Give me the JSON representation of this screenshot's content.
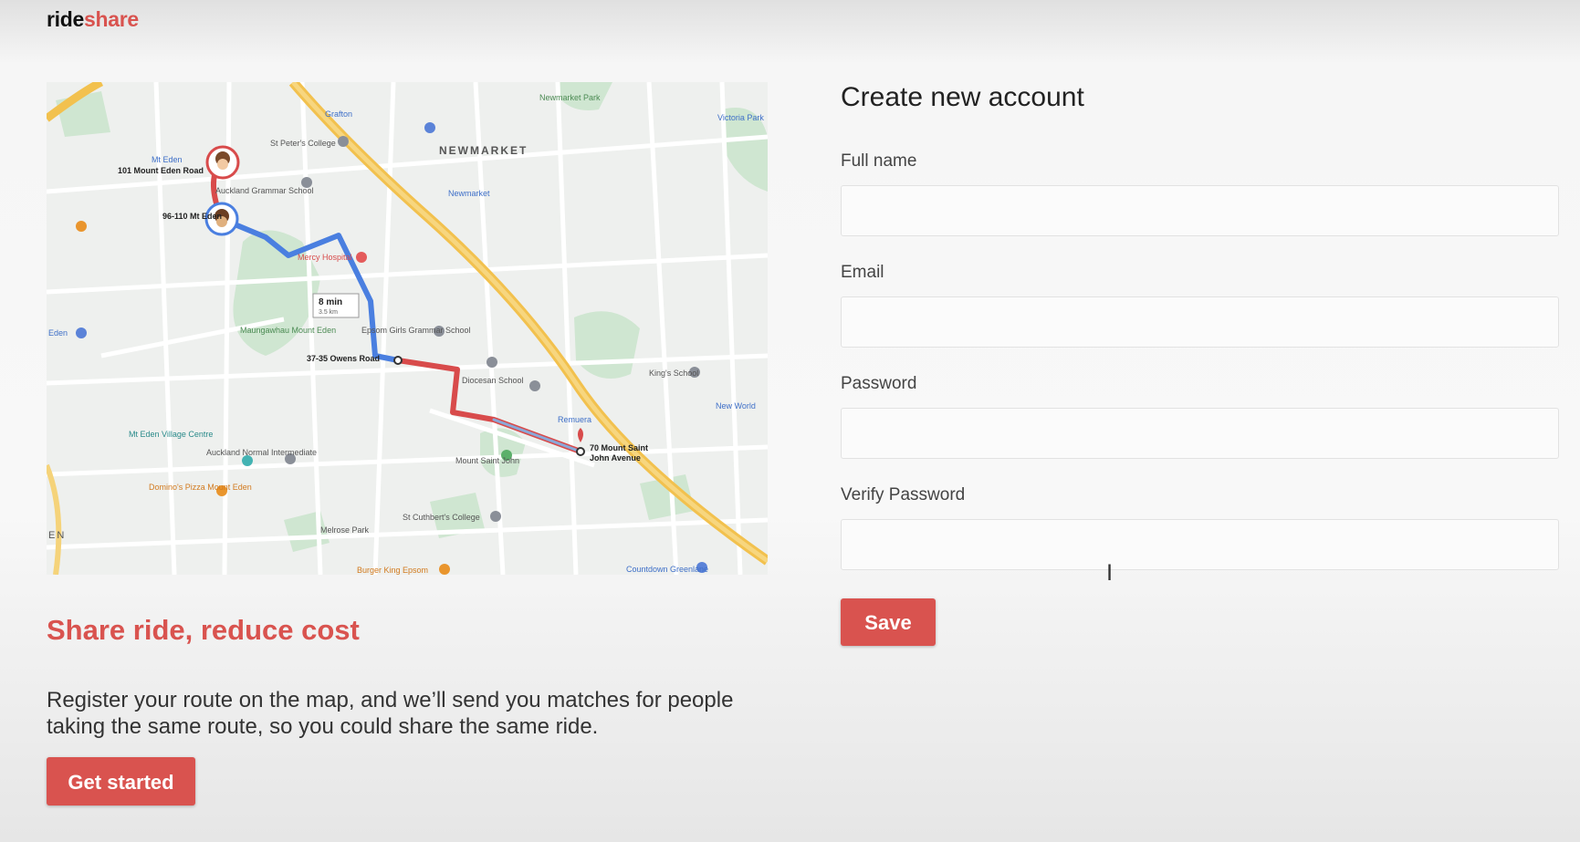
{
  "brand": {
    "part1": "ride",
    "part2": "share"
  },
  "hero": {
    "title": "Share ride, reduce cost",
    "text": "Register your route on the map, and we’ll send you matches for people taking the same route, so you could share the same ride.",
    "cta_label": "Get started"
  },
  "map": {
    "labels": {
      "newmarket": "NEWMARKET",
      "start": "101 Mount Eden Road",
      "mid": "96-110 Mt Eden",
      "waypoint": "37-35 Owens Road",
      "dest_line1": "70 Mount Saint",
      "dest_line2": "John Avenue",
      "duration": "8 min",
      "distance": "3.5 km",
      "st_peters": "St Peter's College",
      "auckland_grammar": "Auckland Grammar School",
      "mercy_hospital": "Mercy Hospital",
      "epsom_girls": "Epsom Girls Grammar School",
      "diocesan": "Diocesan School",
      "kings_school": "King's School",
      "mt_eden_village": "Mt Eden Village Centre",
      "auckland_normal": "Auckland Normal Intermediate",
      "dominos": "Domino's Pizza Mount Eden",
      "mount_st_john": "Mount Saint John",
      "st_cuthberts": "St Cuthbert's College",
      "melrose_park": "Melrose Park",
      "maungawhau": "Maungawhau Mount Eden",
      "remuera": "Remuera",
      "new_world": "New World",
      "countdown": "Countdown Greenlane",
      "burger_king": "Burger King Epsom",
      "grafton": "Grafton",
      "mt_eden_station": "Mt Eden",
      "newmarket_station": "Newmarket",
      "newmarket_park": "Newmarket Park",
      "victoria_park": "Victoria Park",
      "eden_left": "Eden",
      "en_edge": "EN"
    },
    "colors": {
      "route_blue": "#4a7fe0",
      "route_red": "#d84b4b",
      "motorway": "#f2c14e",
      "park": "#c9e5cc"
    }
  },
  "form": {
    "title": "Create new account",
    "fields": [
      {
        "label": "Full name",
        "value": "",
        "placeholder": ""
      },
      {
        "label": "Email",
        "value": "",
        "placeholder": ""
      },
      {
        "label": "Password",
        "value": "",
        "placeholder": ""
      },
      {
        "label": "Verify Password",
        "value": "",
        "placeholder": ""
      }
    ],
    "save_label": "Save"
  },
  "cursor": {
    "glyph": "I"
  }
}
